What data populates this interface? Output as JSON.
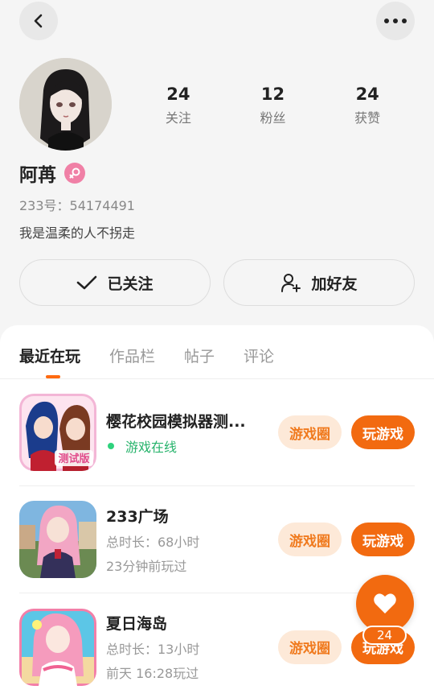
{
  "profile": {
    "name": "阿苒",
    "user_id": "233号：54174491",
    "bio": "我是温柔的人不拐走",
    "stats": [
      {
        "value": "24",
        "label": "关注"
      },
      {
        "value": "12",
        "label": "粉丝"
      },
      {
        "value": "24",
        "label": "获赞"
      }
    ]
  },
  "actions": {
    "followed_label": "已关注",
    "add_friend_label": "加好友"
  },
  "tabs": [
    "最近在玩",
    "作品栏",
    "帖子",
    "评论"
  ],
  "games": [
    {
      "title": "樱花校园模拟器测...",
      "line1": "游戏在线",
      "line2": "",
      "icon_badge": "测试版"
    },
    {
      "title": "233广场",
      "line1": "总时长：68小时",
      "line2": "23分钟前玩过"
    },
    {
      "title": "夏日海岛",
      "line1": "总时长：13小时",
      "line2": "前天 16:28玩过"
    }
  ],
  "game_buttons": {
    "circle_label": "游戏圈",
    "play_label": "玩游戏"
  },
  "floating": {
    "like_count": "24"
  },
  "colors": {
    "accent": "#f26a10",
    "online": "#26b36b",
    "gender_badge": "#f080a6"
  }
}
